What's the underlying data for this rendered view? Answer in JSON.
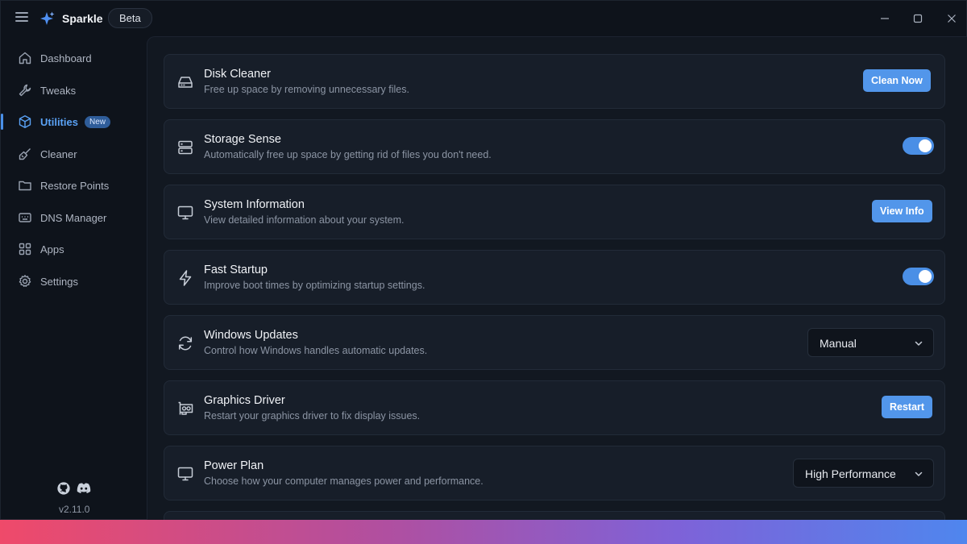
{
  "app": {
    "name": "Sparkle",
    "badge": "Beta",
    "version": "v2.11.0"
  },
  "colors": {
    "accent": "#5296ea",
    "active_nav": "#5aa2f5",
    "background": "#0e131b",
    "card": "#171e29"
  },
  "icons": {
    "menu": "hamburger-icon",
    "logo": "sparkle-icon",
    "minimize": "minimize-icon",
    "maximize": "maximize-icon",
    "close": "close-icon",
    "github": "github-icon",
    "discord": "discord-icon"
  },
  "sidebar": {
    "items": [
      {
        "label": "Dashboard",
        "icon": "home-icon"
      },
      {
        "label": "Tweaks",
        "icon": "wrench-icon"
      },
      {
        "label": "Utilities",
        "icon": "cube-icon",
        "badge": "New",
        "active": true
      },
      {
        "label": "Cleaner",
        "icon": "brush-icon"
      },
      {
        "label": "Restore Points",
        "icon": "folder-icon"
      },
      {
        "label": "DNS Manager",
        "icon": "network-icon"
      },
      {
        "label": "Apps",
        "icon": "grid-icon"
      },
      {
        "label": "Settings",
        "icon": "gear-icon"
      }
    ]
  },
  "cards": [
    {
      "title": "Disk Cleaner",
      "desc": "Free up space by removing unnecessary files.",
      "control": "button",
      "button_label": "Clean Now",
      "icon": "hard-drive-icon"
    },
    {
      "title": "Storage Sense",
      "desc": "Automatically free up space by getting rid of files you don't need.",
      "control": "toggle",
      "toggle_on": true,
      "icon": "storage-icon"
    },
    {
      "title": "System Information",
      "desc": "View detailed information about your system.",
      "control": "button",
      "button_label": "View Info",
      "icon": "monitor-icon"
    },
    {
      "title": "Fast Startup",
      "desc": "Improve boot times by optimizing startup settings.",
      "control": "toggle",
      "toggle_on": true,
      "icon": "lightning-icon"
    },
    {
      "title": "Windows Updates",
      "desc": "Control how Windows handles automatic updates.",
      "control": "select",
      "selected": "Manual",
      "icon": "refresh-icon"
    },
    {
      "title": "Graphics Driver",
      "desc": "Restart your graphics driver to fix display issues.",
      "control": "button",
      "button_label": "Restart",
      "icon": "gpu-icon"
    },
    {
      "title": "Power Plan",
      "desc": "Choose how your computer manages power and performance.",
      "control": "select",
      "selected": "High Performance",
      "icon": "monitor-icon"
    }
  ]
}
